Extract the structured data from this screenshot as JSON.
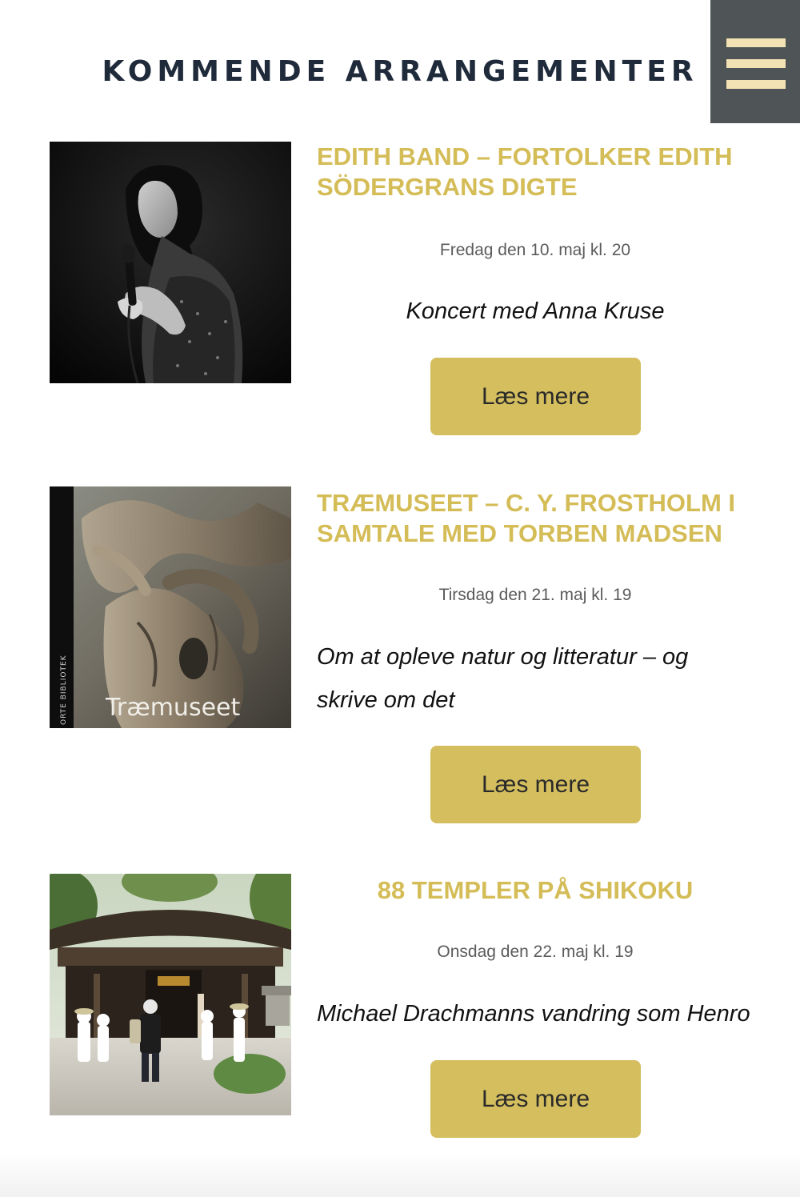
{
  "header": {
    "title": "KOMMENDE ARRANGEMENTER",
    "menu_icon": "hamburger-icon"
  },
  "colors": {
    "title": "#1f2a3a",
    "event_title": "#d4bc57",
    "button_bg": "#d4be5e",
    "menu_bg": "#4f5456",
    "menu_bars": "#f3e2b3"
  },
  "events": [
    {
      "title": "EDITH BAND – FORTOLKER EDITH SÖDERGRANS DIGTE",
      "date": "Fredag den 10. maj kl. 20",
      "description": "Koncert med Anna Kruse",
      "button_label": "Læs mere"
    },
    {
      "title": "TRÆMUSEET – C. Y. FROSTHOLM I SAMTALE MED TORBEN MADSEN",
      "date": "Tirsdag den 21. maj kl. 19",
      "description": "Om at opleve natur og litteratur – og skrive om det",
      "button_label": "Læs mere",
      "image_text": "Træmuseet",
      "image_spine_text": "ORTE BIBLIOTEK"
    },
    {
      "title": "88 TEMPLER PÅ SHIKOKU",
      "date": "Onsdag den 22. maj kl. 19",
      "description": "Michael Drachmanns vandring som Henro",
      "button_label": "Læs mere"
    }
  ]
}
